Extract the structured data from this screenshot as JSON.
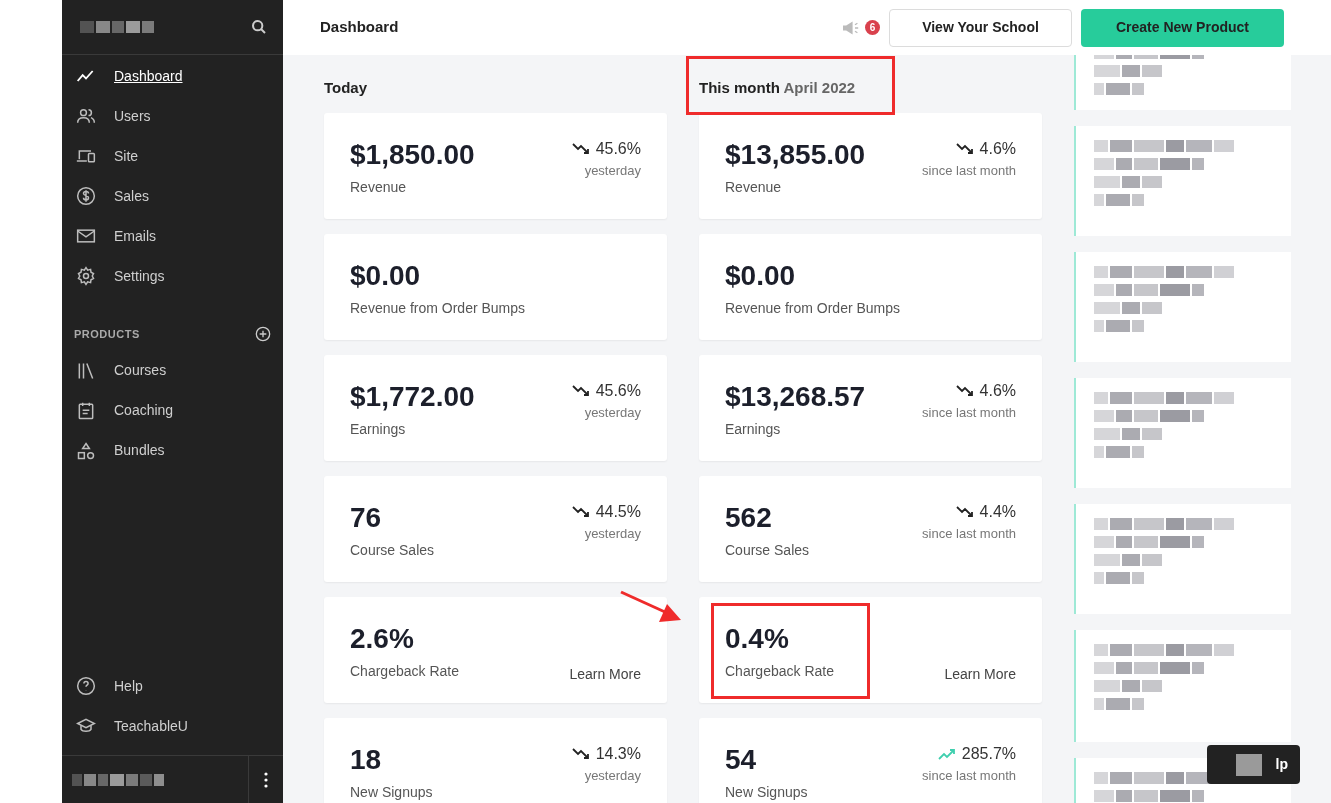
{
  "sidebar": {
    "nav": [
      {
        "label": "Dashboard",
        "selected": true
      },
      {
        "label": "Users",
        "selected": false
      },
      {
        "label": "Site",
        "selected": false
      },
      {
        "label": "Sales",
        "selected": false
      },
      {
        "label": "Emails",
        "selected": false
      },
      {
        "label": "Settings",
        "selected": false
      }
    ],
    "products_heading": "PRODUCTS",
    "products": [
      {
        "label": "Courses",
        "selected": false
      },
      {
        "label": "Coaching",
        "selected": false
      },
      {
        "label": "Bundles",
        "selected": false
      }
    ],
    "footer_links": [
      {
        "label": "Help"
      },
      {
        "label": "TeachableU"
      }
    ]
  },
  "header": {
    "title": "Dashboard",
    "notification_count": "6",
    "buttons": [
      {
        "label": "View Your School",
        "kind": "secondary"
      },
      {
        "label": "Create New Product",
        "kind": "primary"
      }
    ]
  },
  "columns": [
    {
      "heading": "Today",
      "cards": [
        {
          "kind": "trend",
          "value": "$1,850.00",
          "label": "Revenue",
          "rising": false,
          "change": "45.6%",
          "period": "yesterday"
        },
        {
          "kind": "plain",
          "value": "$0.00",
          "label": "Revenue from Order Bumps"
        },
        {
          "kind": "trend",
          "value": "$1,772.00",
          "label": "Earnings",
          "rising": false,
          "change": "45.6%",
          "period": "yesterday"
        },
        {
          "kind": "trend",
          "value": "76",
          "label": "Course Sales",
          "rising": false,
          "change": "44.5%",
          "period": "yesterday"
        },
        {
          "kind": "link",
          "value": "2.6%",
          "label": "Chargeback Rate",
          "link": "Learn More"
        },
        {
          "kind": "trend",
          "value": "18",
          "label": "New Signups",
          "rising": false,
          "change": "14.3%",
          "period": "yesterday"
        }
      ]
    },
    {
      "heading": "This month",
      "heading_suffix": "April 2022",
      "cards": [
        {
          "kind": "trend",
          "value": "$13,855.00",
          "label": "Revenue",
          "rising": false,
          "change": "4.6%",
          "period": "since last month"
        },
        {
          "kind": "plain",
          "value": "$0.00",
          "label": "Revenue from Order Bumps"
        },
        {
          "kind": "trend",
          "value": "$13,268.57",
          "label": "Earnings",
          "rising": false,
          "change": "4.6%",
          "period": "since last month"
        },
        {
          "kind": "trend",
          "value": "562",
          "label": "Course Sales",
          "rising": false,
          "change": "4.4%",
          "period": "since last month"
        },
        {
          "kind": "link",
          "value": "0.4%",
          "label": "Chargeback Rate",
          "link": "Learn More"
        },
        {
          "kind": "trend",
          "value": "54",
          "label": "New Signups",
          "rising": true,
          "change": "285.7%",
          "period": "since last month"
        }
      ]
    }
  ],
  "help_button": {
    "label": "lp"
  }
}
